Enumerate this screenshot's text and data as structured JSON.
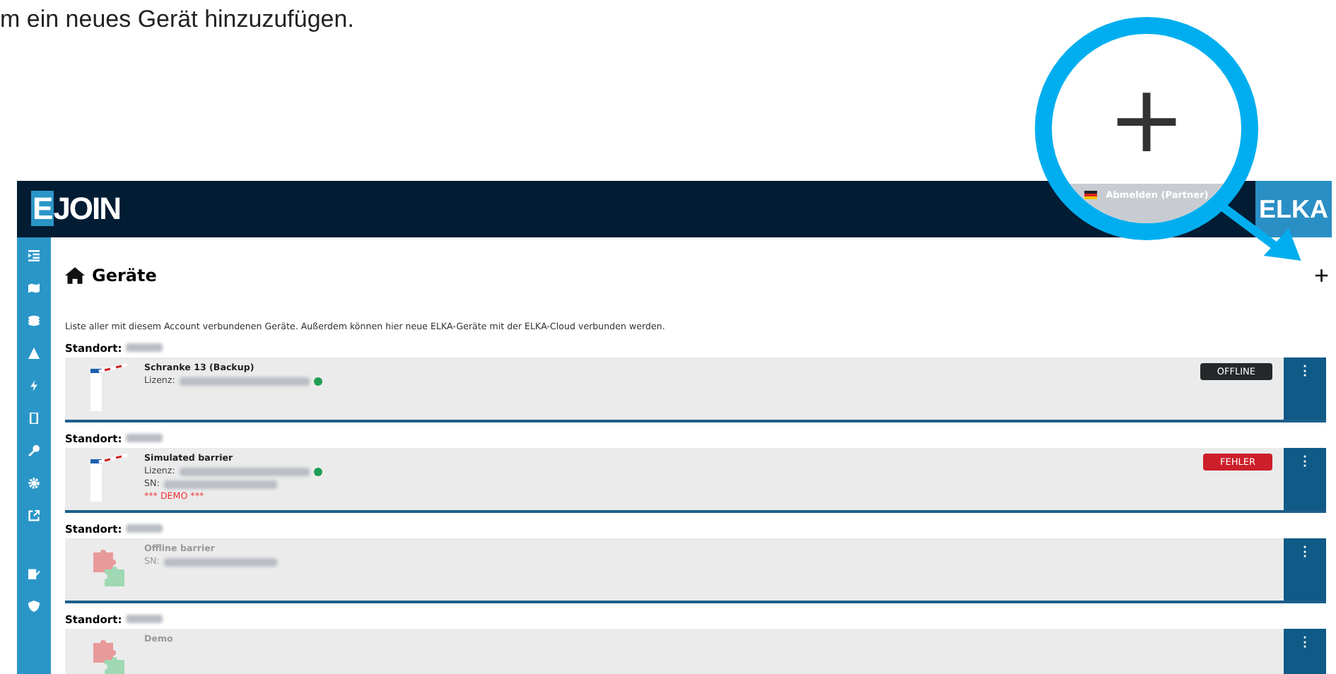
{
  "caption": "m ein neues Gerät hinzuzufügen.",
  "header": {
    "logo_accent": "E",
    "logo_rest": "JOIN",
    "brand": "ELKA"
  },
  "magnifier": {
    "icon": "+",
    "logout": "Abmelden (Partner)"
  },
  "page": {
    "title": "Geräte",
    "add": "+",
    "description": "Liste aller mit diesem Account verbundenen Geräte. Außerdem können hier neue ELKA-Geräte mit der ELKA-Cloud verbunden werden."
  },
  "groups": [
    {
      "label": "Standort:",
      "devices": [
        {
          "kind": "barrier",
          "name": "Schranke 13 (Backup)",
          "license_label": "Lizenz:",
          "online": true,
          "status": {
            "kind": "offline",
            "label": "OFFLINE"
          },
          "menu": "⋮"
        }
      ]
    },
    {
      "label": "Standort:",
      "devices": [
        {
          "kind": "barrier",
          "name": "Simulated barrier",
          "license_label": "Lizenz:",
          "online": true,
          "sn_label": "SN:",
          "demo": "*** DEMO ***",
          "status": {
            "kind": "error",
            "label": "FEHLER"
          },
          "menu": "⋮"
        }
      ]
    },
    {
      "label": "Standort:",
      "devices": [
        {
          "kind": "puzzle",
          "name": "Offline barrier",
          "sn_label": "SN:",
          "menu": "⋮"
        }
      ]
    },
    {
      "label": "Standort:",
      "devices": [
        {
          "kind": "puzzle",
          "name": "Demo",
          "menu": "⋮"
        }
      ]
    }
  ]
}
